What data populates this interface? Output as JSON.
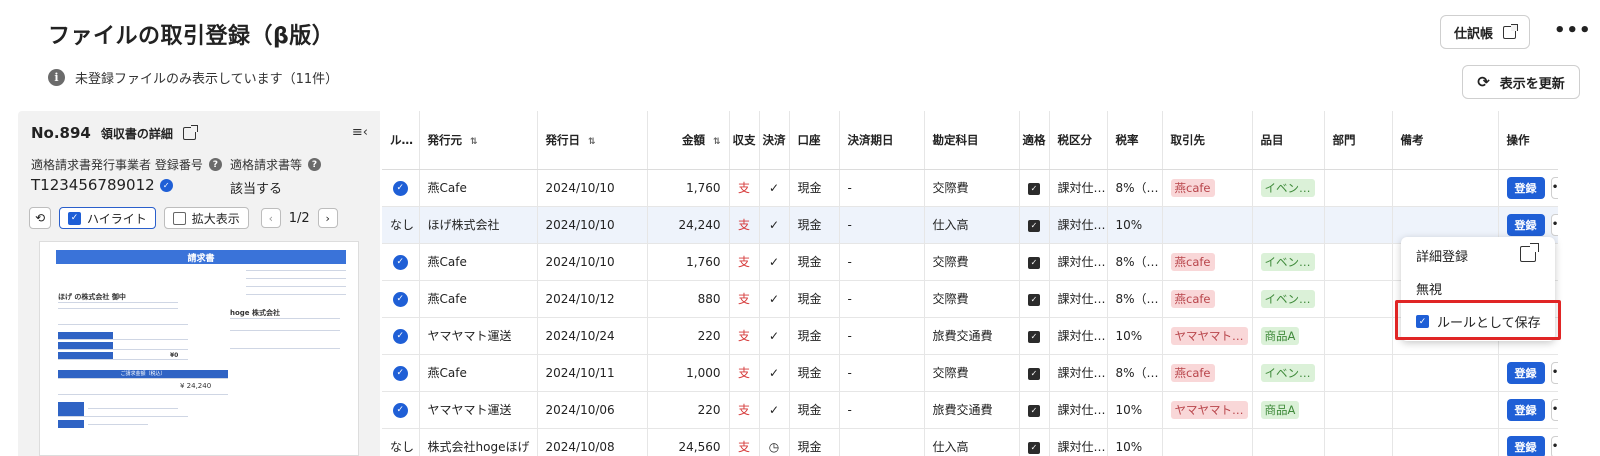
{
  "header": {
    "title": "ファイルの取引登録（β版）",
    "info_text": "未登録ファイルのみ表示しています（11件）",
    "journal_label": "仕訳帳",
    "refresh_label": "表示を更新",
    "more": "•••"
  },
  "doc": {
    "number": "No.894",
    "detail_label": "領収書の詳細",
    "reg_label": "適格請求書発行事業者 登録番号",
    "reg_value": "T123456789012",
    "qi_label": "適格請求書等",
    "qi_value": "該当する",
    "highlight_label": "ハイライト",
    "zoom_label": "拡大表示",
    "page": "1/2"
  },
  "receipt": {
    "title": "請求書",
    "to": "ほげ の株式会社 御中",
    "from": "hoge 株式会社",
    "amount": "¥ 24,240",
    "vq": "¥0",
    "sub_title": "ご請求金額（税込）"
  },
  "table": {
    "headers": [
      "ル…",
      "発行元",
      "発行日",
      "金額",
      "収支",
      "決済",
      "口座",
      "決済期日",
      "勘定科目",
      "適格",
      "税区分",
      "税率",
      "取引先",
      "品目",
      "部門",
      "備考",
      "操作"
    ],
    "rows": [
      {
        "rule": "check",
        "issuer": "燕Cafe",
        "date": "2024/10/10",
        "amount": "1,760",
        "type": "支",
        "settle": "✓",
        "account": "現金",
        "due": "-",
        "subject": "交際費",
        "tax_class": "課対仕…",
        "rate": "8%（…",
        "partner": "燕cafe",
        "item": "イベン…",
        "dept": "",
        "memo": "",
        "action": "登録"
      },
      {
        "rule": "なし",
        "issuer": "ほげ株式会社",
        "date": "2024/10/10",
        "amount": "24,240",
        "type": "支",
        "settle": "✓",
        "account": "現金",
        "due": "-",
        "subject": "仕入高",
        "tax_class": "課対仕…",
        "rate": "10%",
        "partner": "",
        "item": "",
        "dept": "",
        "memo": "",
        "action": "登録"
      },
      {
        "rule": "check",
        "issuer": "燕Cafe",
        "date": "2024/10/10",
        "amount": "1,760",
        "type": "支",
        "settle": "✓",
        "account": "現金",
        "due": "-",
        "subject": "交際費",
        "tax_class": "課対仕…",
        "rate": "8%（…",
        "partner": "燕cafe",
        "item": "イベン…",
        "dept": "",
        "memo": "",
        "action": ""
      },
      {
        "rule": "check",
        "issuer": "燕Cafe",
        "date": "2024/10/12",
        "amount": "880",
        "type": "支",
        "settle": "✓",
        "account": "現金",
        "due": "-",
        "subject": "交際費",
        "tax_class": "課対仕…",
        "rate": "8%（…",
        "partner": "燕cafe",
        "item": "イベン…",
        "dept": "",
        "memo": "",
        "action": ""
      },
      {
        "rule": "check",
        "issuer": "ヤマヤマト運送",
        "date": "2024/10/24",
        "amount": "220",
        "type": "支",
        "settle": "✓",
        "account": "現金",
        "due": "-",
        "subject": "旅費交通費",
        "tax_class": "課対仕…",
        "rate": "10%",
        "partner": "ヤマヤマト…",
        "item": "商品A",
        "dept": "",
        "memo": "",
        "action": ""
      },
      {
        "rule": "check",
        "issuer": "燕Cafe",
        "date": "2024/10/11",
        "amount": "1,000",
        "type": "支",
        "settle": "✓",
        "account": "現金",
        "due": "-",
        "subject": "交際費",
        "tax_class": "課対仕…",
        "rate": "8%（…",
        "partner": "燕cafe",
        "item": "イベン…",
        "dept": "",
        "memo": "",
        "action": "登録"
      },
      {
        "rule": "check",
        "issuer": "ヤマヤマト運送",
        "date": "2024/10/06",
        "amount": "220",
        "type": "支",
        "settle": "✓",
        "account": "現金",
        "due": "-",
        "subject": "旅費交通費",
        "tax_class": "課対仕…",
        "rate": "10%",
        "partner": "ヤマヤマト…",
        "item": "商品A",
        "dept": "",
        "memo": "",
        "action": "登録"
      },
      {
        "rule": "なし",
        "issuer": "株式会社hogeほげ",
        "date": "2024/10/08",
        "amount": "24,560",
        "type": "支",
        "settle": "◷",
        "account": "現金",
        "due": "",
        "subject": "仕入高",
        "tax_class": "課対仕…",
        "rate": "10%",
        "partner": "",
        "item": "",
        "dept": "",
        "memo": "",
        "action": "登録"
      }
    ]
  },
  "menu": {
    "detail": "詳細登録",
    "ignore": "無視",
    "save_rule": "ルールとして保存"
  }
}
